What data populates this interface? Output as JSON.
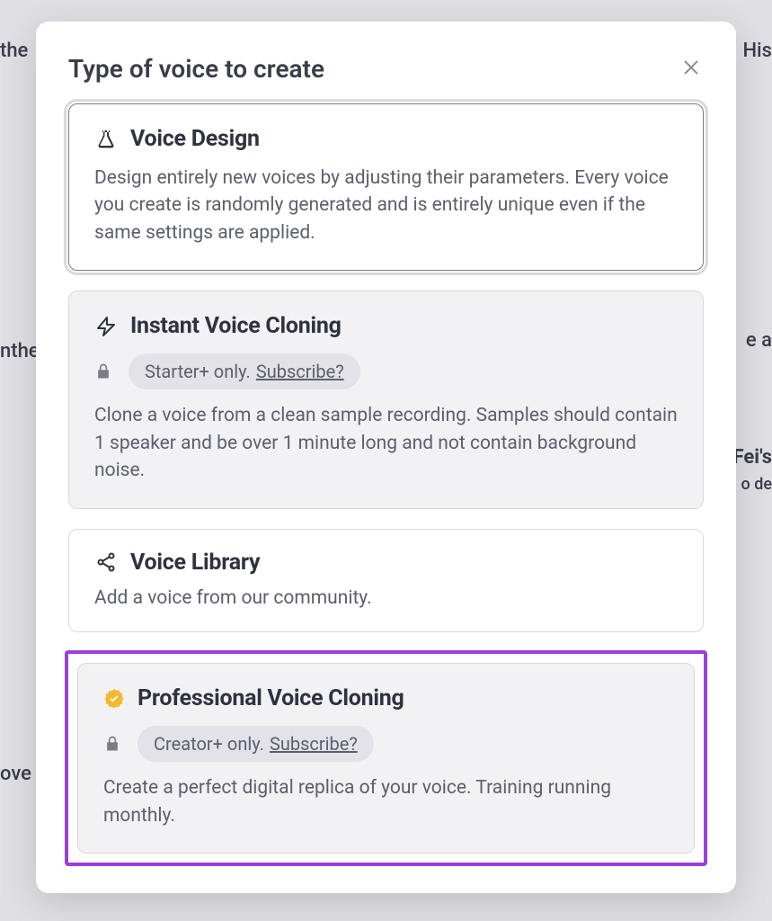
{
  "bg": {
    "topLeft": "the",
    "topRight": "His",
    "midLeft": "nthe",
    "midRight1": "e a",
    "midRight2": "Fei's",
    "midRight3": "o de",
    "bottomLeft": "ove"
  },
  "modal": {
    "title": "Type of voice to create",
    "options": [
      {
        "key": "voice-design",
        "title": "Voice Design",
        "desc": "Design entirely new voices by adjusting their parameters. Every voice you create is randomly generated and is entirely unique even if the same settings are applied."
      },
      {
        "key": "instant-cloning",
        "title": "Instant Voice Cloning",
        "lockText": "Starter+ only. ",
        "subscribe": "Subscribe?",
        "desc": "Clone a voice from a clean sample recording. Samples should contain 1 speaker and be over 1 minute long and not contain background noise."
      },
      {
        "key": "voice-library",
        "title": "Voice Library",
        "desc": "Add a voice from our community."
      },
      {
        "key": "pro-cloning",
        "title": "Professional Voice Cloning",
        "lockText": "Creator+ only. ",
        "subscribe": "Subscribe?",
        "desc": "Create a perfect digital replica of your voice. Training running monthly."
      }
    ]
  }
}
